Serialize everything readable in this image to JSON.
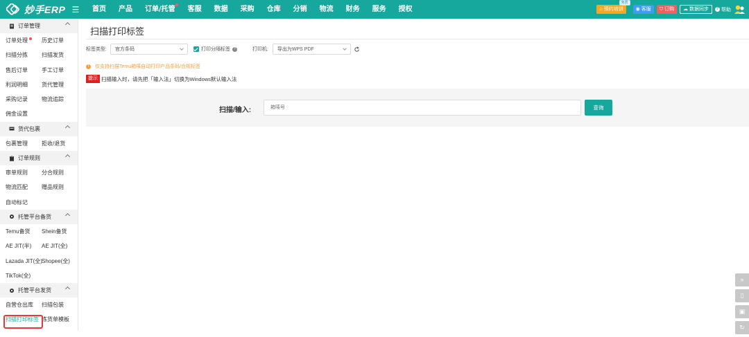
{
  "app": {
    "logo_text": "妙手ERP",
    "nav": [
      {
        "label": "首页",
        "dot": false
      },
      {
        "label": "产品",
        "dot": false
      },
      {
        "label": "订单/托管",
        "dot": true
      },
      {
        "label": "客服",
        "dot": false
      },
      {
        "label": "数据",
        "dot": false
      },
      {
        "label": "采购",
        "dot": false
      },
      {
        "label": "仓库",
        "dot": false
      },
      {
        "label": "分销",
        "dot": false
      },
      {
        "label": "物流",
        "dot": false
      },
      {
        "label": "财务",
        "dot": false
      },
      {
        "label": "服务",
        "dot": false
      },
      {
        "label": "授权",
        "dot": false
      }
    ],
    "top_right": {
      "training": "预约培训",
      "free_tag": "免费",
      "service": "客服",
      "order": "订购",
      "sync": "数据同步",
      "help": "帮助"
    },
    "colors": {
      "primary": "#16a89c",
      "orange": "#f5a623",
      "blue": "#3d9df2",
      "red": "#f06060",
      "tip_red": "#e02020"
    }
  },
  "sidebar": {
    "sections": [
      {
        "title": "订单管理",
        "icon": "document-icon",
        "items": [
          "订单处理",
          "历史订单",
          "扫描分拣",
          "扫描发货",
          "售后订单",
          "手工订单",
          "利润明细",
          "货代管理",
          "采购记录",
          "物流追踪",
          "佣金设置"
        ]
      },
      {
        "title": "货代包裹",
        "icon": "truck-icon",
        "items": [
          "包裹管理",
          "拒收/退货"
        ]
      },
      {
        "title": "订单规则",
        "icon": "clipboard-icon",
        "items": [
          "审单规则",
          "分合规则",
          "物流匹配",
          "赠品规则",
          "自动标记"
        ]
      },
      {
        "title": "托管平台备货",
        "icon": "gear-icon",
        "items": [
          "Temu备货",
          "Shein备货",
          "AE JIT(半)",
          "AE JIT(全)",
          "Lazada JIT(全)",
          "Shopee(全)",
          "TikTok(全)"
        ]
      },
      {
        "title": "托管平台发货",
        "icon": "gear-icon",
        "items": [
          "自营仓出库",
          "扫描包装",
          "扫描打印标签",
          "拣货单模板"
        ]
      }
    ],
    "active_item": "扫描打印标签"
  },
  "main": {
    "title": "扫描打印标签",
    "filters": {
      "label_type_label": "标签类型:",
      "label_type_value": "官方条码",
      "print_split_label": "打印分隔标签",
      "printer_label": "打印机:",
      "printer_value": "导出为WPS PDF"
    },
    "notice": "仅支持扫描Temu箱唛自动打印产品条码/合规标签",
    "tip_badge": "提示",
    "tip_text": "扫描输入时，请先把「输入法」切换为Windows默认输入法",
    "scan": {
      "label": "扫描/输入:",
      "placeholder": "箱唛号",
      "query_button": "查询"
    }
  }
}
